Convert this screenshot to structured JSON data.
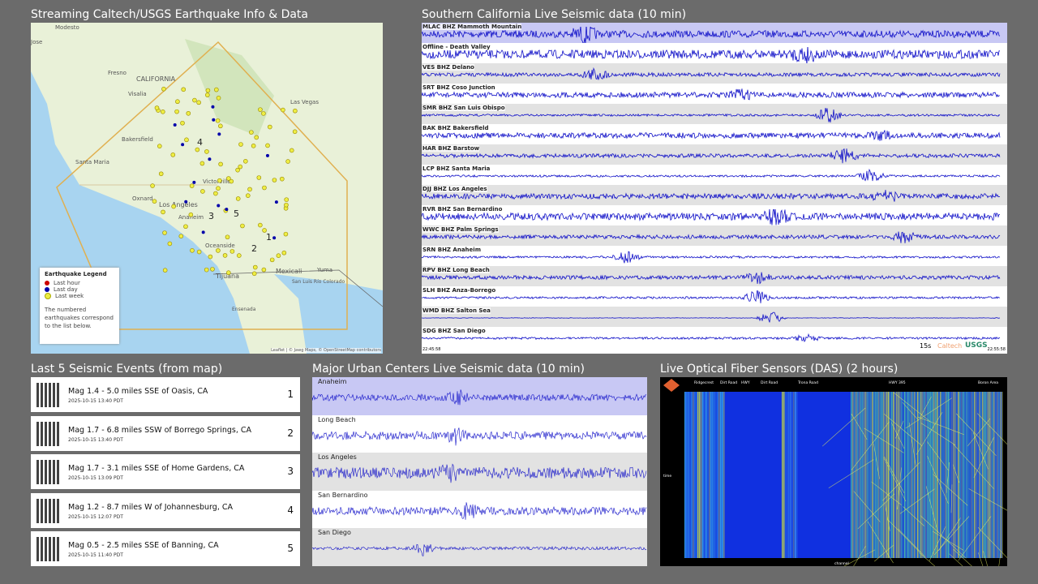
{
  "titles": {
    "map": "Streaming Caltech/USGS Earthquake Info & Data",
    "seismic": "Southern California Live Seismic data (10 min)",
    "events": "Last 5 Seismic Events (from map)",
    "urban": "Major Urban Centers Live Seismic data (10 min)",
    "das": "Live Optical Fiber Sensors (DAS) (2 hours)"
  },
  "map": {
    "places": [
      "Modesto",
      "Jose",
      "Fresno",
      "CALIFORNIA",
      "Visalia",
      "Las Vegas",
      "Bakersfield",
      "Santa Maria",
      "Victorville",
      "Oxnard",
      "Los Angeles",
      "Anaheim",
      "Oceanside",
      "Tijuana",
      "Mexicali",
      "Yuma",
      "San Luis Río Colorado",
      "Ensenada"
    ],
    "markers": [
      "1",
      "2",
      "3",
      "4",
      "5"
    ],
    "legend": {
      "title": "Earthquake Legend",
      "items": [
        {
          "label": "Last hour",
          "color": "#cc0000"
        },
        {
          "label": "Last day",
          "color": "#0000aa"
        },
        {
          "label": "Last week",
          "color": "#eeee44"
        }
      ],
      "note": "The numbered earthquakes correspond to the list below."
    },
    "attribution": "Leaflet | © Jawg Maps, © OpenStreetMap contributors"
  },
  "seismic": {
    "stations": [
      "MLAC BHZ Mammoth Mountain",
      "Offline - Death Valley",
      "VES BHZ Delano",
      "SRT BHZ Coso Junction",
      "SMR BHZ San Luis Obispo",
      "BAK BHZ Bakersfield",
      "HAR BHZ Barstow",
      "LCP BHZ Santa Maria",
      "DJJ BHZ Los Angeles",
      "RVR BHZ San Bernardino",
      "WWC BHZ Palm Springs",
      "SRN BHZ Anaheim",
      "RPV BHZ Long Beach",
      "SLH BHZ Anza-Borrego",
      "WMD BHZ Salton Sea",
      "SDG BHZ San Diego"
    ],
    "time_start": "22:45:58",
    "time_end": "22:55:58",
    "scale": "15s",
    "logo_caltech": "Caltech",
    "logo_usgs": "USGS",
    "trace_color": "#1010c8"
  },
  "events": [
    {
      "title": "Mag 1.4 - 5.0 miles SSE of Oasis, CA",
      "date": "2025-10-15 13:40 PDT",
      "num": "1"
    },
    {
      "title": "Mag 1.7 - 6.8 miles SSW of Borrego Springs, CA",
      "date": "2025-10-15 13:40 PDT",
      "num": "2"
    },
    {
      "title": "Mag 1.7 - 3.1 miles SSE of Home Gardens, CA",
      "date": "2025-10-15 13:09 PDT",
      "num": "3"
    },
    {
      "title": "Mag 1.2 - 8.7 miles W of Johannesburg, CA",
      "date": "2025-10-15 12:07 PDT",
      "num": "4"
    },
    {
      "title": "Mag 0.5 - 2.5 miles SSE of Banning, CA",
      "date": "2025-10-15 11:40 PDT",
      "num": "5"
    }
  ],
  "urban": {
    "cities": [
      "Anaheim",
      "Long Beach",
      "Los Angeles",
      "San Bernardino",
      "San Diego"
    ]
  },
  "das": {
    "segments": [
      "Ridgecrest",
      "Dirt Road",
      "HWY",
      "Dirt Road",
      "Trona Road",
      "HWY 395",
      "Boron Area"
    ],
    "xlabel": "channel",
    "ylabel": "time"
  }
}
